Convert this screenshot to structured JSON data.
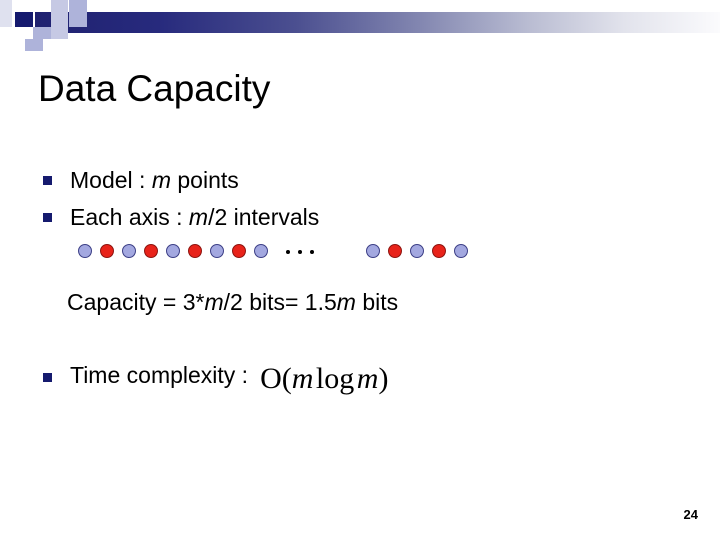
{
  "slide": {
    "title": "Data Capacity",
    "page_number": "24",
    "accent_navy": "#151a6e",
    "accent_periwinkle": "#aeb3da",
    "dot_blue": "#a3a8e0",
    "dot_red": "#e8231a"
  },
  "bullets": [
    {
      "id": "model",
      "prefix": "Model : ",
      "variable": "m",
      "suffix": " points"
    },
    {
      "id": "each-axis",
      "prefix": "Each axis : ",
      "variable": "m",
      "suffix": "/2 intervals"
    },
    {
      "id": "time-complexity",
      "prefix": "Time complexity : ",
      "variable": "",
      "suffix": ""
    }
  ],
  "dot_row": {
    "left_group": [
      "blue",
      "red",
      "blue",
      "red",
      "blue",
      "red",
      "blue",
      "red",
      "blue"
    ],
    "ellipsis": "···",
    "right_group": [
      "blue",
      "red",
      "blue",
      "red",
      "blue"
    ]
  },
  "capacity": {
    "label": "Capacity  =  3*",
    "var1": "m",
    "mid": "/2 bits= 1.5",
    "var2": "m",
    "tail": " bits"
  },
  "formula": {
    "big_o": "O(",
    "var1": "m",
    "log": "log",
    "var2": "m",
    "close": ")"
  }
}
